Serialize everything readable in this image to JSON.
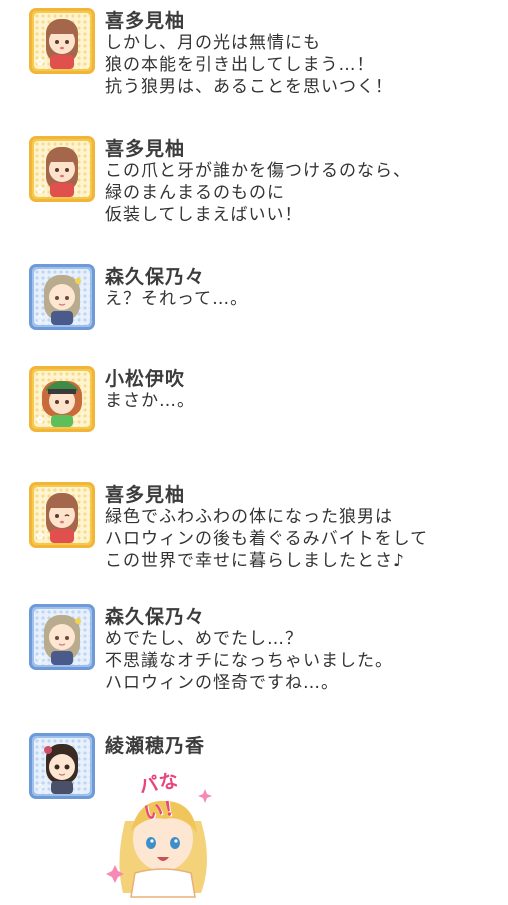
{
  "messages": [
    {
      "speaker": "喜多見柚",
      "type": "cute",
      "lines": [
        "しかし、月の光は無情にも",
        "狼の本能を引き出してしまう…！",
        "抗う狼男は、あることを思いつく！"
      ]
    },
    {
      "speaker": "喜多見柚",
      "type": "cute",
      "lines": [
        "この爪と牙が誰かを傷つけるのなら、",
        "緑のまんまるのものに",
        "仮装してしまえばいい！"
      ]
    },
    {
      "speaker": "森久保乃々",
      "type": "cool",
      "lines": [
        "え？それって…。"
      ]
    },
    {
      "speaker": "小松伊吹",
      "type": "cute",
      "lines": [
        "まさか…。"
      ]
    },
    {
      "speaker": "喜多見柚",
      "type": "cute",
      "lines": [
        "緑色でふわふわの体になった狼男は",
        "ハロウィンの後も着ぐるみバイトをして",
        "この世界で幸せに暮らしましたとさ♪"
      ]
    },
    {
      "speaker": "森久保乃々",
      "type": "cool",
      "lines": [
        "めでたし、めでたし…？",
        "不思議なオチになっちゃいました。",
        "ハロウィンの怪奇ですね…。"
      ]
    },
    {
      "speaker": "綾瀬穂乃香",
      "type": "cool",
      "sticker_text": "パない！"
    }
  ],
  "colors": {
    "cute_frame": "#f2b53a",
    "cool_frame": "#6e9ad8",
    "name_text": "#3c3c3c"
  }
}
